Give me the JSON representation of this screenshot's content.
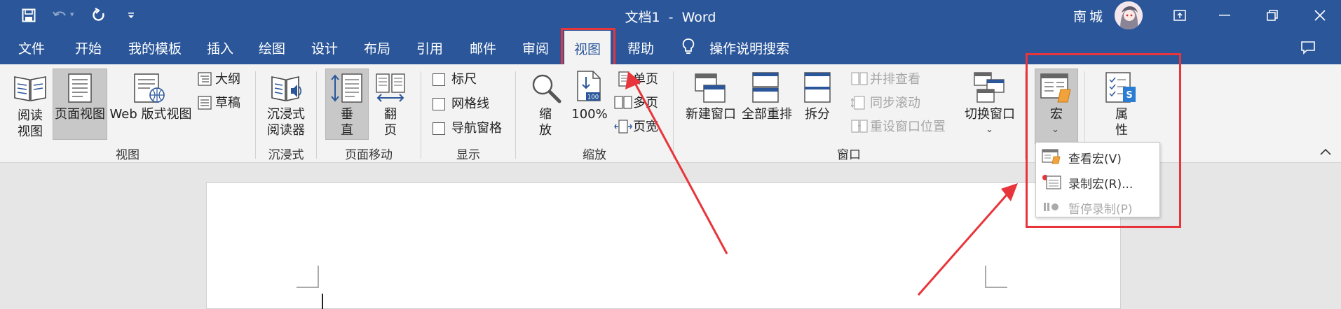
{
  "window": {
    "title": "文档1  -  Word",
    "user_name": "南城"
  },
  "tabs": [
    {
      "label": "文件"
    },
    {
      "label": "开始"
    },
    {
      "label": "我的模板"
    },
    {
      "label": "插入"
    },
    {
      "label": "绘图"
    },
    {
      "label": "设计"
    },
    {
      "label": "布局"
    },
    {
      "label": "引用"
    },
    {
      "label": "邮件"
    },
    {
      "label": "审阅"
    },
    {
      "label": "视图",
      "active": true
    },
    {
      "label": "帮助"
    },
    {
      "label": "操作说明搜索"
    }
  ],
  "groups": {
    "view": {
      "label": "视图",
      "read_mode": "阅读\n视图",
      "print_layout": "页面视图",
      "web_layout": "Web 版式视图",
      "outline": "大纲",
      "draft": "草稿"
    },
    "immersive": {
      "label": "沉浸式",
      "reader": "沉浸式\n阅读器"
    },
    "page_movement": {
      "label": "页面移动",
      "vertical": "垂\n直",
      "side_to_side": "翻\n页"
    },
    "show": {
      "label": "显示",
      "ruler": "标尺",
      "gridlines": "网格线",
      "nav_pane": "导航窗格"
    },
    "zoom": {
      "label": "缩放",
      "zoom": "缩\n放",
      "hundred": "100%",
      "one_page": "单页",
      "multiple_pages": "多页",
      "page_width": "页宽"
    },
    "window": {
      "label": "窗口",
      "new_window": "新建窗口",
      "arrange_all": "全部重排",
      "split": "拆分",
      "side_by_side": "并排查看",
      "sync_scroll": "同步滚动",
      "reset_position": "重设窗口位置",
      "switch_windows": "切换窗口"
    },
    "macros": {
      "macros": "宏",
      "properties": "属\n性"
    }
  },
  "macro_menu": {
    "items": [
      {
        "label": "查看宏(V)",
        "enabled": true
      },
      {
        "label": "录制宏(R)...",
        "enabled": true
      },
      {
        "label": "暂停录制(P)",
        "enabled": false
      }
    ]
  },
  "colors": {
    "accent": "#2b579a",
    "highlight": "#e8353b"
  }
}
